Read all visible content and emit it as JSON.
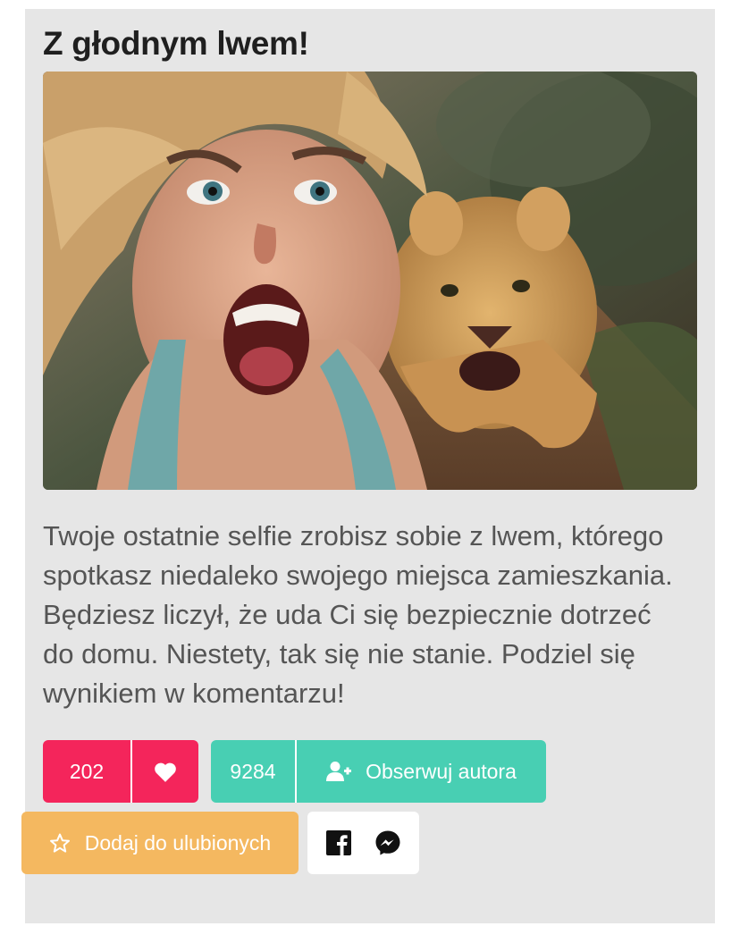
{
  "quiz_result": {
    "title": "Z głodnym lwem!",
    "description": "Twoje ostatnie selfie zrobisz sobie z lwem, którego spotkasz niedaleko swojego miejsca zamieszkania. Będziesz liczył, że uda Ci się bezpiecznie dotrzeć do domu. Niestety, tak się nie stanie. Podziel się wynikiem w komentarzu!",
    "image": {
      "subject": "woman-selfie-with-charging-lioness"
    }
  },
  "actions": {
    "likes_count": "202",
    "like_icon": "heart-icon",
    "followers_count": "9284",
    "follow_label": "Obserwuj autora",
    "follow_icon": "user-plus-icon",
    "favorite_label": "Dodaj do ulubionych",
    "favorite_icon": "star-outline-icon",
    "share_icons": [
      "facebook-icon",
      "messenger-icon"
    ]
  },
  "colors": {
    "card_background": "#e6e6e6",
    "like": "#f4255b",
    "follow": "#48cfb3",
    "favorite": "#f4b860"
  }
}
